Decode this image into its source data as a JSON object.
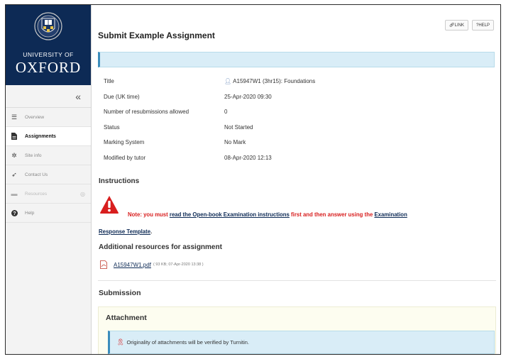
{
  "sidebar": {
    "university_of": "UNIVERSITY OF",
    "oxford": "OXFORD",
    "collapse_glyph": "«",
    "items": [
      {
        "label": "Overview",
        "icon": "list-icon"
      },
      {
        "label": "Assignments",
        "icon": "document-icon"
      },
      {
        "label": "Site info",
        "icon": "gear-icon"
      },
      {
        "label": "Contact Us",
        "icon": "send-icon"
      },
      {
        "label": "Resources",
        "icon": "folder-icon"
      },
      {
        "label": "Help",
        "icon": "question-icon"
      }
    ]
  },
  "header": {
    "title": "Submit Example Assignment",
    "link_label": "LINK",
    "help_label": "?HELP"
  },
  "details": [
    {
      "key": "Title",
      "value": "A15947W1 (3hr15): Foundations"
    },
    {
      "key": "Due (UK time)",
      "value": "25-Apr-2020 09:30"
    },
    {
      "key": "Number of resubmissions allowed",
      "value": "0"
    },
    {
      "key": "Status",
      "value": "Not Started"
    },
    {
      "key": "Marking System",
      "value": "No Mark"
    },
    {
      "key": "Modified by tutor",
      "value": "08-Apr-2020 12:13"
    }
  ],
  "instructions": {
    "heading": "Instructions",
    "note_prefix": "Note: you must ",
    "note_link1": "read the Open-book Examination instructions",
    "note_middle": " first and then answer using the ",
    "note_link2a": "Examination",
    "note_link2b": "Response Template",
    "note_end": "."
  },
  "resources": {
    "heading": "Additional resources for assignment",
    "file_name": "A15947W1.pdf",
    "file_meta": "( 93 KB; 07-Apr-2020 13:38 )"
  },
  "submission": {
    "heading": "Submission",
    "attachment_heading": "Attachment",
    "turnitin_note": "Originality of attachments will be verified by Turnitin."
  },
  "colors": {
    "brand": "#0d2a55",
    "info_bg": "#d9edf7",
    "warning_red": "#d81e1e"
  }
}
